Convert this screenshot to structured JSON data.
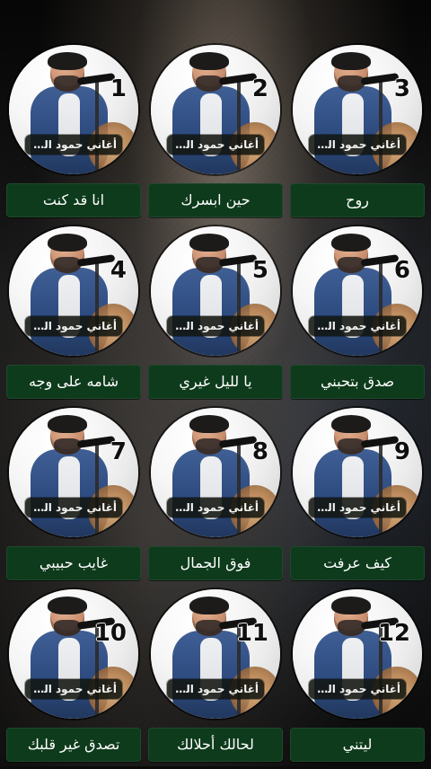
{
  "thumbnail_caption": "أغاني حمود السمه",
  "items": [
    {
      "number": "1",
      "title": "انا قد كنت"
    },
    {
      "number": "2",
      "title": "حين ابسرك"
    },
    {
      "number": "3",
      "title": "روح"
    },
    {
      "number": "4",
      "title": "شامه على وجه"
    },
    {
      "number": "5",
      "title": "يا لليل غيري"
    },
    {
      "number": "6",
      "title": "صدق بتحبني"
    },
    {
      "number": "7",
      "title": "غايب حبيبي"
    },
    {
      "number": "8",
      "title": "فوق الجمال"
    },
    {
      "number": "9",
      "title": "كيف عرفت"
    },
    {
      "number": "10",
      "title": "تصدق غير قلبك"
    },
    {
      "number": "11",
      "title": "لحالك أحلالك"
    },
    {
      "number": "12",
      "title": "ليتني"
    }
  ]
}
